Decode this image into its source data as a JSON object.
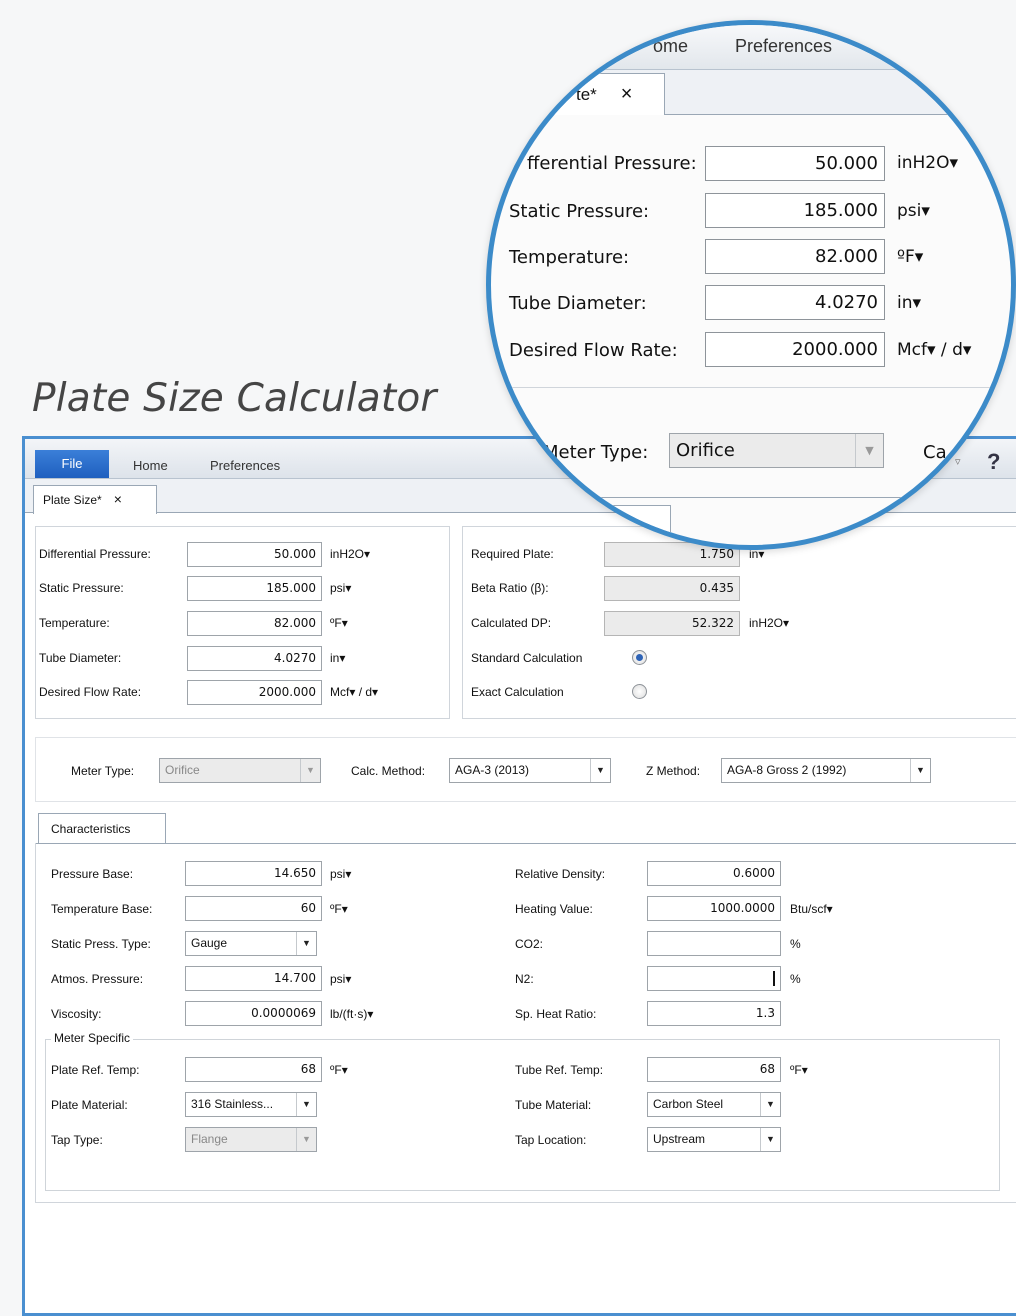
{
  "page_title": "Plate Size Calculator",
  "menu": {
    "file": "File",
    "home": "Home",
    "preferences": "Preferences",
    "help": "?"
  },
  "doc_tab": {
    "label": "Plate Size*",
    "close": "×"
  },
  "inputs": {
    "differential_pressure": {
      "label": "Differential Pressure:",
      "value": "50.000",
      "unit": "inH2O▾"
    },
    "static_pressure": {
      "label": "Static Pressure:",
      "value": "185.000",
      "unit": "psi▾"
    },
    "temperature": {
      "label": "Temperature:",
      "value": "82.000",
      "unit": "ºF▾"
    },
    "tube_diameter": {
      "label": "Tube Diameter:",
      "value": "4.0270",
      "unit": "in▾"
    },
    "desired_flow_rate": {
      "label": "Desired Flow Rate:",
      "value": "2000.000",
      "unit": "Mcf▾ / d▾"
    }
  },
  "results": {
    "required_plate": {
      "label": "Required Plate:",
      "value": "1.750",
      "unit": "in▾"
    },
    "beta_ratio": {
      "label": "Beta Ratio (β):",
      "value": "0.435"
    },
    "calculated_dp": {
      "label": "Calculated DP:",
      "value": "52.322",
      "unit": "inH2O▾"
    },
    "standard_calculation": {
      "label": "Standard Calculation",
      "selected": true
    },
    "exact_calculation": {
      "label": "Exact Calculation",
      "selected": false
    }
  },
  "methods": {
    "meter_type": {
      "label": "Meter Type:",
      "value": "Orifice"
    },
    "calc_method": {
      "label": "Calc. Method:",
      "value": "AGA-3 (2013)"
    },
    "z_method": {
      "label": "Z Method:",
      "value": "AGA-8 Gross 2 (1992)"
    }
  },
  "characteristics_tab": "Characteristics",
  "characteristics": {
    "pressure_base": {
      "label": "Pressure Base:",
      "value": "14.650",
      "unit": "psi▾"
    },
    "temperature_base": {
      "label": "Temperature Base:",
      "value": "60",
      "unit": "ºF▾"
    },
    "static_press_type": {
      "label": "Static Press. Type:",
      "value": "Gauge"
    },
    "atmos_pressure": {
      "label": "Atmos. Pressure:",
      "value": "14.700",
      "unit": "psi▾"
    },
    "viscosity": {
      "label": "Viscosity:",
      "value": "0.0000069",
      "unit": "lb/(ft·s)▾"
    },
    "relative_density": {
      "label": "Relative Density:",
      "value": "0.6000"
    },
    "heating_value": {
      "label": "Heating Value:",
      "value": "1000.0000",
      "unit": "Btu/scf▾"
    },
    "co2": {
      "label": "CO2:",
      "value": "",
      "unit": "%"
    },
    "n2": {
      "label": "N2:",
      "value": "",
      "unit": "%"
    },
    "sp_heat_ratio": {
      "label": "Sp. Heat Ratio:",
      "value": "1.3"
    }
  },
  "meter_specific": {
    "legend": "Meter Specific",
    "plate_ref_temp": {
      "label": "Plate Ref. Temp:",
      "value": "68",
      "unit": "ºF▾"
    },
    "plate_material": {
      "label": "Plate Material:",
      "value": "316 Stainless..."
    },
    "tap_type": {
      "label": "Tap Type:",
      "value": "Flange"
    },
    "tube_ref_temp": {
      "label": "Tube Ref. Temp:",
      "value": "68",
      "unit": "ºF▾"
    },
    "tube_material": {
      "label": "Tube Material:",
      "value": "Carbon Steel"
    },
    "tap_location": {
      "label": "Tap Location:",
      "value": "Upstream"
    }
  },
  "magnifier": {
    "menu_home": "ome",
    "menu_preferences": "Preferences",
    "tab_label": "te*",
    "tab_close": "×",
    "dp_label": "fferential Pressure:",
    "calc_label": "Ca"
  }
}
